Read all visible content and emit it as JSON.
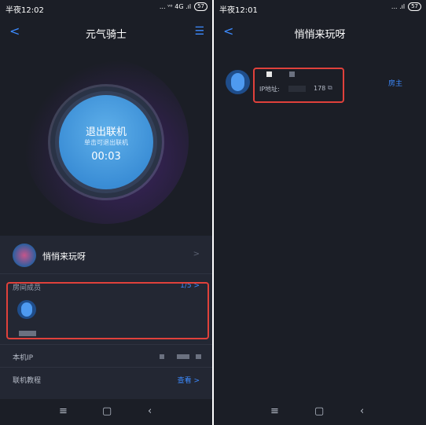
{
  "left": {
    "status": {
      "time": "半夜12:02",
      "signal": "... ᵛᵒ 4G .ıl",
      "battery": "57"
    },
    "nav": {
      "back": "<",
      "title": "元气骑士",
      "menu": "☰"
    },
    "connect_button": {
      "label": "退出联机",
      "hint": "单击可退出联机",
      "timer": "00:03"
    },
    "room": {
      "name": "悄悄来玩呀",
      "chevron": ">"
    },
    "members": {
      "label": "房间成员",
      "count": "1/5 >"
    },
    "local_ip": {
      "label": "本机IP"
    },
    "tutorial": {
      "label": "联机教程",
      "link": "查看 >"
    },
    "bottom_nav": {
      "menu": "≡",
      "home": "▢",
      "back": "‹"
    }
  },
  "right": {
    "status": {
      "time": "半夜12:01",
      "signal": "... .ıl",
      "battery": "57"
    },
    "nav": {
      "back": "<",
      "title": "悄悄来玩呀"
    },
    "member": {
      "ip_label": "IP地址:",
      "ip_suffix": "178",
      "role": "房主"
    },
    "bottom_nav": {
      "menu": "≡",
      "home": "▢",
      "back": "‹"
    }
  },
  "colors": {
    "accent": "#3d8bff",
    "highlight": "#e0413b",
    "background": "#1b1e26"
  }
}
